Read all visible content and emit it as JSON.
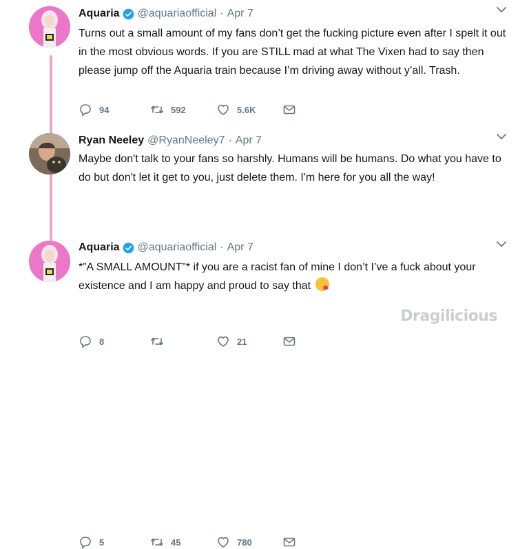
{
  "tweets": [
    {
      "name": "Aquaria",
      "verified": true,
      "handle": "@aquariaofficial",
      "date": "Apr 7",
      "text": "Turns out a small amount of my fans don’t get the fucking picture even after I spelt it out in the most obvious words. If you are STILL mad at what The Vixen had to say then please jump off the Aquaria train because I’m driving away without y’all. Trash.",
      "replies": "94",
      "retweets": "592",
      "likes": "5.6K"
    },
    {
      "name": "Ryan Neeley",
      "verified": false,
      "handle": "@RyanNeeley7",
      "date": "Apr 7",
      "text": "Maybe don't talk to your fans so harshly. Humans will be humans. Do what you have to do but don't let it get to you, just delete them. I'm here for you all the way!",
      "replies": "8",
      "retweets": "",
      "likes": "21"
    },
    {
      "name": "Aquaria",
      "verified": true,
      "handle": "@aquariaofficial",
      "date": "Apr 7",
      "text": "*”A SMALL AMOUNT”* if you are a racist fan of mine I don’t I’ve a fuck about your existence and I am happy and proud to say that",
      "emoji": "kissing-face-emoji",
      "replies": "5",
      "retweets": "45",
      "likes": "780"
    }
  ],
  "separator": "·",
  "watermark": "Dragilicious",
  "colors": {
    "verified": "#1da1f2",
    "thread_line": "#f2a3c4",
    "muted": "#657786",
    "text": "#14171a"
  },
  "icons": [
    "reply-icon",
    "retweet-icon",
    "like-icon",
    "message-icon",
    "chevron-down-icon",
    "verified-icon"
  ]
}
